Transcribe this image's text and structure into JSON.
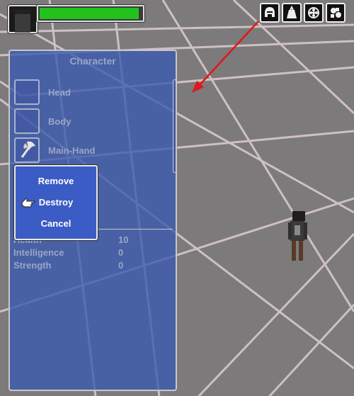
{
  "hud": {
    "health_fill_fraction": 0.97,
    "health_color": "#22c11e",
    "portrait_icon": "character-portrait-icon"
  },
  "top_icons": [
    {
      "name": "helmet-icon"
    },
    {
      "name": "bag-icon"
    },
    {
      "name": "gear-cog-icon"
    },
    {
      "name": "puzzle-settings-icon"
    }
  ],
  "panel": {
    "title": "Character",
    "slots": [
      {
        "label": "Head",
        "icon": "empty-slot"
      },
      {
        "label": "Body",
        "icon": "empty-slot"
      },
      {
        "label": "Main-Hand",
        "icon": "axe-icon"
      }
    ],
    "stats": [
      {
        "name": "Health",
        "value": "10"
      },
      {
        "name": "Intelligence",
        "value": "0"
      },
      {
        "name": "Strength",
        "value": "0"
      }
    ]
  },
  "context_menu": {
    "items": [
      "Remove",
      "Destroy",
      "Cancel"
    ],
    "hovered": "Destroy"
  },
  "colors": {
    "panel_bg": "#3a58af",
    "menu_bg": "#3b5cc4",
    "label_text": "#9aa6c9",
    "menu_text": "#ffffff",
    "arrow": "#e01818"
  }
}
